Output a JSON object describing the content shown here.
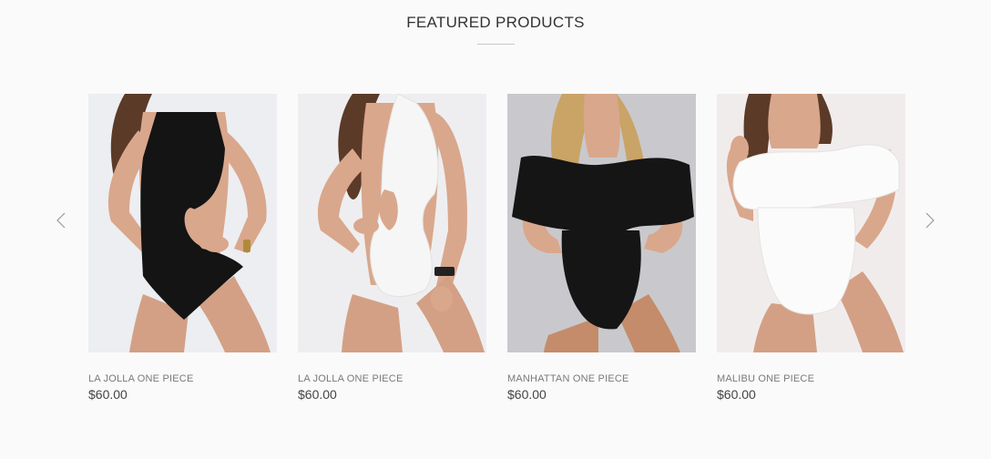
{
  "section": {
    "title": "FEATURED PRODUCTS"
  },
  "carousel": {
    "prev_icon": "chevron-left-icon",
    "next_icon": "chevron-right-icon"
  },
  "products": [
    {
      "name": "LA JOLLA ONE PIECE",
      "price": "$60.00",
      "swimsuit_color": "#141414",
      "backdrop": "#eceef1"
    },
    {
      "name": "LA JOLLA ONE PIECE",
      "price": "$60.00",
      "swimsuit_color": "#f6f6f6",
      "backdrop": "#eeeef0"
    },
    {
      "name": "MANHATTAN ONE PIECE",
      "price": "$60.00",
      "swimsuit_color": "#151515",
      "backdrop": "#c9c9cd"
    },
    {
      "name": "MALIBU ONE PIECE",
      "price": "$60.00",
      "swimsuit_color": "#fbfbfb",
      "backdrop": "#f1ecec"
    }
  ],
  "colors": {
    "background": "#fbfafb",
    "skin": "#d9a78c",
    "hair_dark": "#5b3a28",
    "hair_blonde": "#c9a466"
  }
}
